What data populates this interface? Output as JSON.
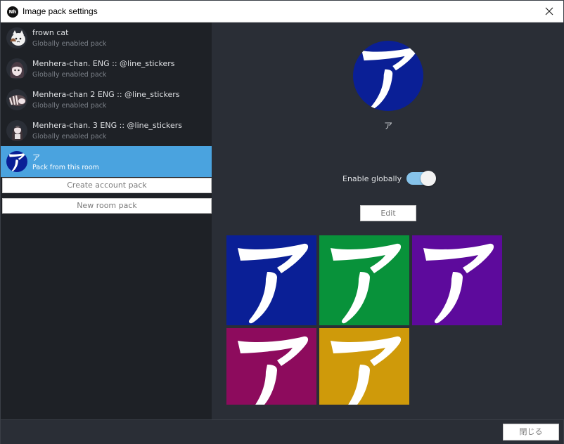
{
  "window": {
    "app_icon_text": "Nh",
    "title": "Image pack settings"
  },
  "sidebar": {
    "packs": [
      {
        "name": "frown cat",
        "subtitle": "Globally enabled pack",
        "avatar": "frown-cat-avatar"
      },
      {
        "name": "Menhera-chan. ENG :: @line_stickers",
        "subtitle": "Globally enabled pack",
        "avatar": "menhera-chan-avatar"
      },
      {
        "name": "Menhera-chan 2 ENG :: @line_stickers",
        "subtitle": "Globally enabled pack",
        "avatar": "menhera-chan-2-avatar"
      },
      {
        "name": "Menhera-chan. 3 ENG :: @line_stickers",
        "subtitle": "Globally enabled pack",
        "avatar": "menhera-chan-3-avatar"
      },
      {
        "name": "ア",
        "subtitle": "Pack from this room",
        "avatar": "katakana-a-avatar",
        "selected": true
      }
    ],
    "create_account_pack": "Create account pack",
    "new_room_pack": "New room pack"
  },
  "main": {
    "pack_title": "ア",
    "enable_globally_label": "Enable globally",
    "enable_globally": true,
    "edit_label": "Edit",
    "stickers": [
      {
        "glyph": "ア",
        "color": "#0a1f96"
      },
      {
        "glyph": "ア",
        "color": "#08923a"
      },
      {
        "glyph": "ア",
        "color": "#5d0a9c"
      },
      {
        "glyph": "ア",
        "color": "#8d0b5d"
      },
      {
        "glyph": "ア",
        "color": "#cf9a0a"
      }
    ]
  },
  "footer": {
    "close_label": "閉じる"
  },
  "colors": {
    "selection": "#4aa3df",
    "toggle_on": "#86c3ea"
  }
}
